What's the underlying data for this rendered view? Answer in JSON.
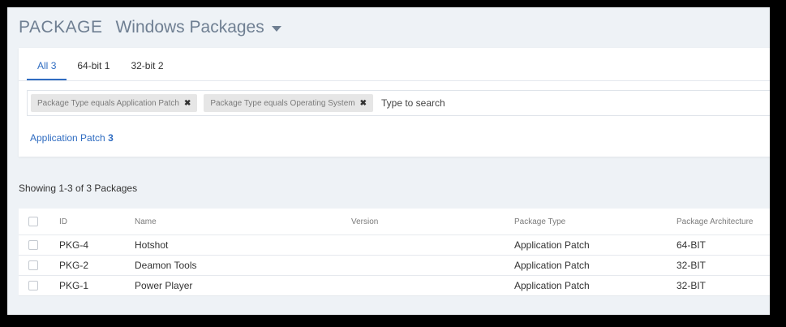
{
  "header": {
    "module": "PACKAGE",
    "title": "Windows Packages"
  },
  "tabs": [
    {
      "label": "All",
      "count": "3"
    },
    {
      "label": "64-bit",
      "count": "1"
    },
    {
      "label": "32-bit",
      "count": "2"
    }
  ],
  "filters": [
    {
      "label": "Package Type equals Application Patch"
    },
    {
      "label": "Package Type equals Operating System"
    }
  ],
  "search": {
    "placeholder": "Type to search"
  },
  "summary": {
    "label": "Application Patch",
    "count": "3"
  },
  "showing": "Showing 1-3 of 3 Packages",
  "table": {
    "columns": [
      "ID",
      "Name",
      "Version",
      "Package Type",
      "Package Architecture"
    ],
    "rows": [
      {
        "id": "PKG-4",
        "name": "Hotshot",
        "version": "",
        "type": "Application Patch",
        "arch": "64-BIT"
      },
      {
        "id": "PKG-2",
        "name": "Deamon Tools",
        "version": "",
        "type": "Application Patch",
        "arch": "32-BIT"
      },
      {
        "id": "PKG-1",
        "name": "Power Player",
        "version": "",
        "type": "Application Patch",
        "arch": "32-BIT"
      }
    ]
  },
  "colors": {
    "accent": "#2f6cc1",
    "header_text": "#6f7f92",
    "background": "#eef2f6"
  }
}
